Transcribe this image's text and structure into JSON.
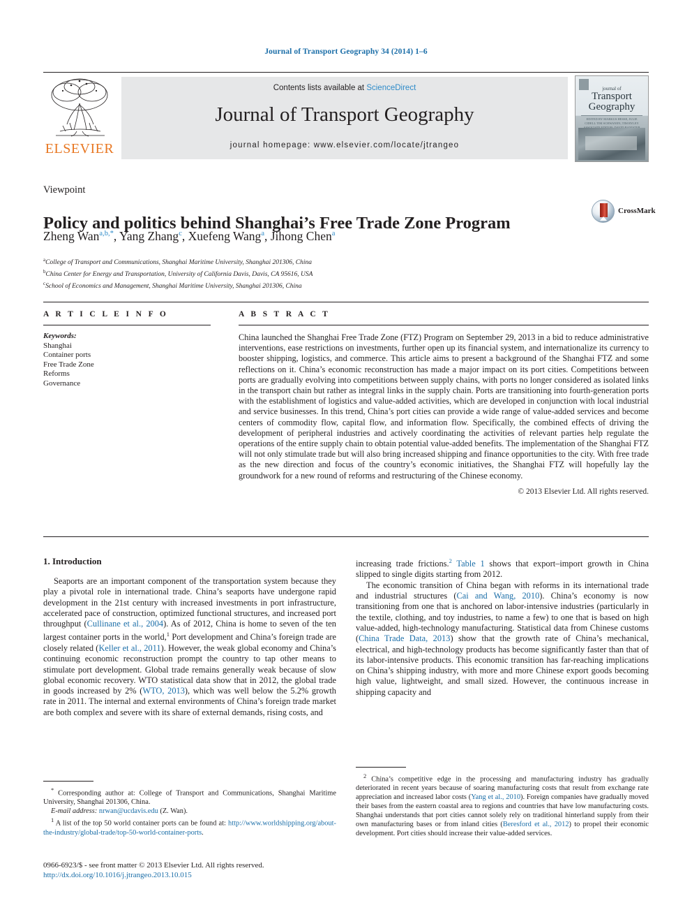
{
  "running_head": "Journal of Transport Geography 34 (2014) 1–6",
  "masthead": {
    "publisher_name": "ELSEVIER",
    "contents_prefix": "Contents lists available at ",
    "contents_link": "ScienceDirect",
    "journal_title": "Journal of Transport Geography",
    "homepage": "journal homepage: www.elsevier.com/locate/jtrangeo",
    "cover": {
      "line1": "journal of",
      "line2": "Transport",
      "line3": "Geography",
      "caption": "EDITED BY MARKUS HESSE, JULIE CIDELL\nTIM SCHWANEN, TIM RYLEY\nASSOCIATE EDITOR: DAVID BANISTER"
    }
  },
  "article": {
    "kicker": "Viewpoint",
    "title": "Policy and politics behind Shanghai’s Free Trade Zone Program",
    "authors": [
      {
        "name": "Zheng Wan",
        "marks": "a,b,*"
      },
      {
        "name": "Yang Zhang",
        "marks": "c"
      },
      {
        "name": "Xuefeng Wang",
        "marks": "a"
      },
      {
        "name": "Jihong Chen",
        "marks": "a"
      }
    ],
    "affiliations": [
      {
        "mark": "a",
        "text": "College of Transport and Communications, Shanghai Maritime University, Shanghai 201306, China"
      },
      {
        "mark": "b",
        "text": "China Center for Energy and Transportation, University of California Davis, Davis, CA 95616, USA"
      },
      {
        "mark": "c",
        "text": "School of Economics and Management, Shanghai Maritime University, Shanghai 201306, China"
      }
    ],
    "crossmark_label": "CrossMark"
  },
  "article_info": {
    "heading": "A R T I C L E    I N F O",
    "keywords_label": "Keywords:",
    "keywords": [
      "Shanghai",
      "Container ports",
      "Free Trade Zone",
      "Reforms",
      "Governance"
    ]
  },
  "abstract": {
    "heading": "A B S T R A C T",
    "text": "China launched the Shanghai Free Trade Zone (FTZ) Program on September 29, 2013 in a bid to reduce administrative interventions, ease restrictions on investments, further open up its financial system, and internationalize its currency to booster shipping, logistics, and commerce. This article aims to present a background of the Shanghai FTZ and some reflections on it. China’s economic reconstruction has made a major impact on its port cities. Competitions between ports are gradually evolving into competitions between supply chains, with ports no longer considered as isolated links in the transport chain but rather as integral links in the supply chain. Ports are transitioning into fourth-generation ports with the establishment of logistics and value-added activities, which are developed in conjunction with local industrial and service businesses. In this trend, China’s port cities can provide a wide range of value-added services and become centers of commodity flow, capital flow, and information flow. Specifically, the combined effects of driving the development of peripheral industries and actively coordinating the activities of relevant parties help regulate the operations of the entire supply chain to obtain potential value-added benefits. The implementation of the Shanghai FTZ will not only stimulate trade but will also bring increased shipping and finance opportunities to the city. With free trade as the new direction and focus of the country’s economic initiatives, the Shanghai FTZ will hopefully lay the groundwork for a new round of reforms and restructuring of the Chinese economy.",
    "copyright": "© 2013 Elsevier Ltd. All rights reserved."
  },
  "body": {
    "section_heading": "1. Introduction",
    "left_paragraph_1_a": "Seaports are an important component of the transportation system because they play a pivotal role in international trade. China’s seaports have undergone rapid development in the 21st century with increased investments in port infrastructure, accelerated pace of construction, optimized functional structures, and increased port throughput (",
    "left_cite_1": "Cullinane et al., 2004",
    "left_paragraph_1_b": "). As of 2012, China is home to seven of the ten largest container ports in the world,",
    "left_fn_mark_1": "1",
    "left_paragraph_1_c": " Port development and China’s foreign trade are closely related (",
    "left_cite_2": "Keller et al., 2011",
    "left_paragraph_1_d": "). However, the weak global economy and China’s continuing economic reconstruction prompt the country to tap other means to stimulate port development. Global trade remains generally weak because of slow global economic recovery. WTO statistical data show that in 2012, the global trade in goods increased by 2% (",
    "left_cite_3": "WTO, 2013",
    "left_paragraph_1_e": "), which was well below the 5.2% growth rate in 2011. The internal and external environments of China’s foreign trade market are both complex and severe with its share of external demands, rising costs, and",
    "right_paragraph_1_a": "increasing trade frictions.",
    "right_fn_mark_2": "2",
    "right_cite_table": " Table 1",
    "right_paragraph_1_b": " shows that export–import growth in China slipped to single digits starting from 2012.",
    "right_paragraph_2_a": "The economic transition of China began with reforms in its international trade and industrial structures (",
    "right_cite_1": "Cai and Wang, 2010",
    "right_paragraph_2_b": "). China’s economy is now transitioning from one that is anchored on labor-intensive industries (particularly in the textile, clothing, and toy industries, to name a few) to one that is based on high value-added, high-technology manufacturing. Statistical data from Chinese customs (",
    "right_cite_2": "China Trade Data, 2013",
    "right_paragraph_2_c": ") show that the growth rate of China’s mechanical, electrical, and high-technology products has become significantly faster than that of its labor-intensive products. This economic transition has far-reaching implications on China’s shipping industry, with more and more Chinese export goods becoming high value, lightweight, and small sized. However, the continuous increase in shipping capacity and"
  },
  "footnotes": {
    "corresponding_mark": "*",
    "corresponding_text": " Corresponding author at: College of Transport and Communications, Shanghai Maritime University, Shanghai 201306, China.",
    "email_label": "E-mail address:",
    "email_link": "nrwan@ucdavis.edu",
    "email_suffix": " (Z. Wan).",
    "fn1_mark": "1",
    "fn1_text": " A list of the top 50 world container ports can be found at: ",
    "fn1_link": "http://www.worldshipping.org/about-the-industry/global-trade/top-50-world-container-ports",
    "fn1_suffix": ".",
    "fn2_mark": "2",
    "fn2_text_a": " China’s competitive edge in the processing and manufacturing industry has gradually deteriorated in recent years because of soaring manufacturing costs that result from exchange rate appreciation and increased labor costs (",
    "fn2_cite_1": "Yang et al., 2010",
    "fn2_text_b": "). Foreign companies have gradually moved their bases from the eastern coastal area to regions and countries that have low manufacturing costs. Shanghai understands that port cities cannot solely rely on traditional hinterland supply from their own manufacturing bases or from inland cities (",
    "fn2_cite_2": "Beresford et al., 2012",
    "fn2_text_c": ") to propel their economic development. Port cities should increase their value-added services."
  },
  "imprint": {
    "issn_line": "0966-6923/$ - see front matter © 2013 Elsevier Ltd. All rights reserved.",
    "doi": "http://dx.doi.org/10.1016/j.jtrangeo.2013.10.015"
  },
  "colors": {
    "link_blue": "#1b6ea8",
    "sciencedirect_blue": "#2e8bc9",
    "elsevier_orange": "#e87722",
    "band_gray": "#e6e7e8"
  }
}
